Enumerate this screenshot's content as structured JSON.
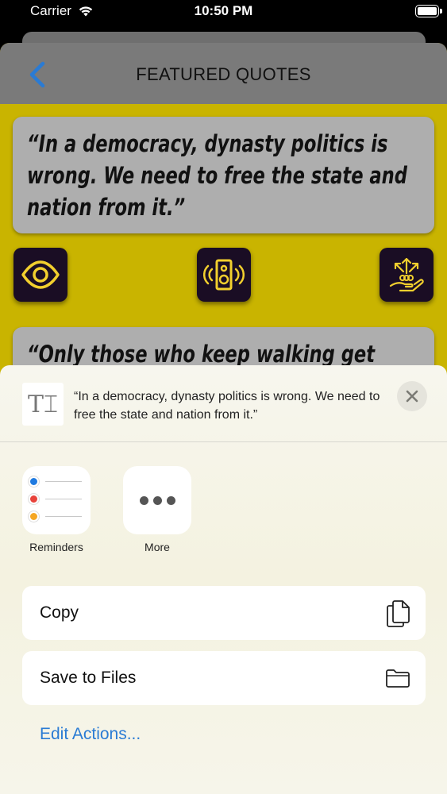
{
  "status_bar": {
    "carrier": "Carrier",
    "time": "10:50 PM"
  },
  "nav": {
    "title": "FEATURED QUOTES"
  },
  "quotes": [
    {
      "text": "“In a democracy, dynasty politics is wrong. We need to free the state and nation from it.”"
    },
    {
      "text": "“Only those who keep walking get sweet"
    }
  ],
  "share_sheet": {
    "preview_text": "“In a democracy, dynasty politics is wrong. We need to free the state and nation from it.”",
    "apps": [
      {
        "label": "Reminders",
        "icon": "reminders-icon"
      },
      {
        "label": "More",
        "icon": "more-icon"
      }
    ],
    "actions": [
      {
        "label": "Copy",
        "icon": "copy-icon"
      },
      {
        "label": "Save to Files",
        "icon": "folder-icon"
      }
    ],
    "edit_actions_label": "Edit Actions..."
  },
  "colors": {
    "app_background": "#c9b400",
    "action_button": "#1a0d24",
    "icon_gold": "#f2cf2e",
    "link_blue": "#2a7bd4",
    "back_arrow": "#2a7bd4"
  }
}
